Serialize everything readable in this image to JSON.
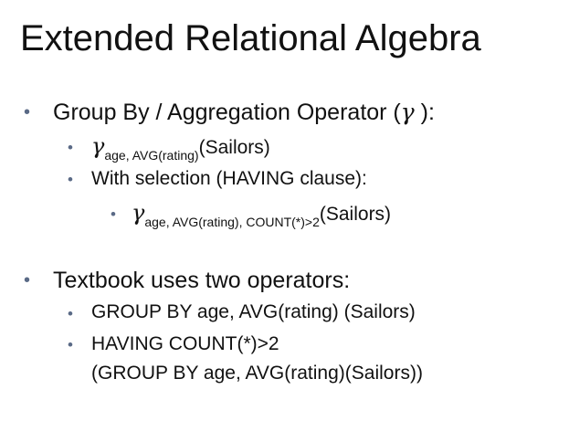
{
  "slide": {
    "title": "Extended Relational Algebra",
    "bullet_char": "•",
    "gamma_symbol": "γ",
    "items": [
      {
        "label_before": "Group By / Aggregation Operator (",
        "label_after": " ):"
      },
      {
        "subscript": "age, AVG(rating)",
        "suffix": "(Sailors)"
      },
      {
        "text": "With selection (HAVING clause):"
      },
      {
        "subscript": "age, AVG(rating), COUNT(*)>2",
        "suffix": "(Sailors)"
      },
      {
        "text": "Textbook uses two operators:"
      },
      {
        "text": "GROUP BY age, AVG(rating) (Sailors)"
      },
      {
        "line1": "HAVING COUNT(*)>2",
        "line2": "(GROUP BY age, AVG(rating)(Sailors))"
      }
    ]
  }
}
